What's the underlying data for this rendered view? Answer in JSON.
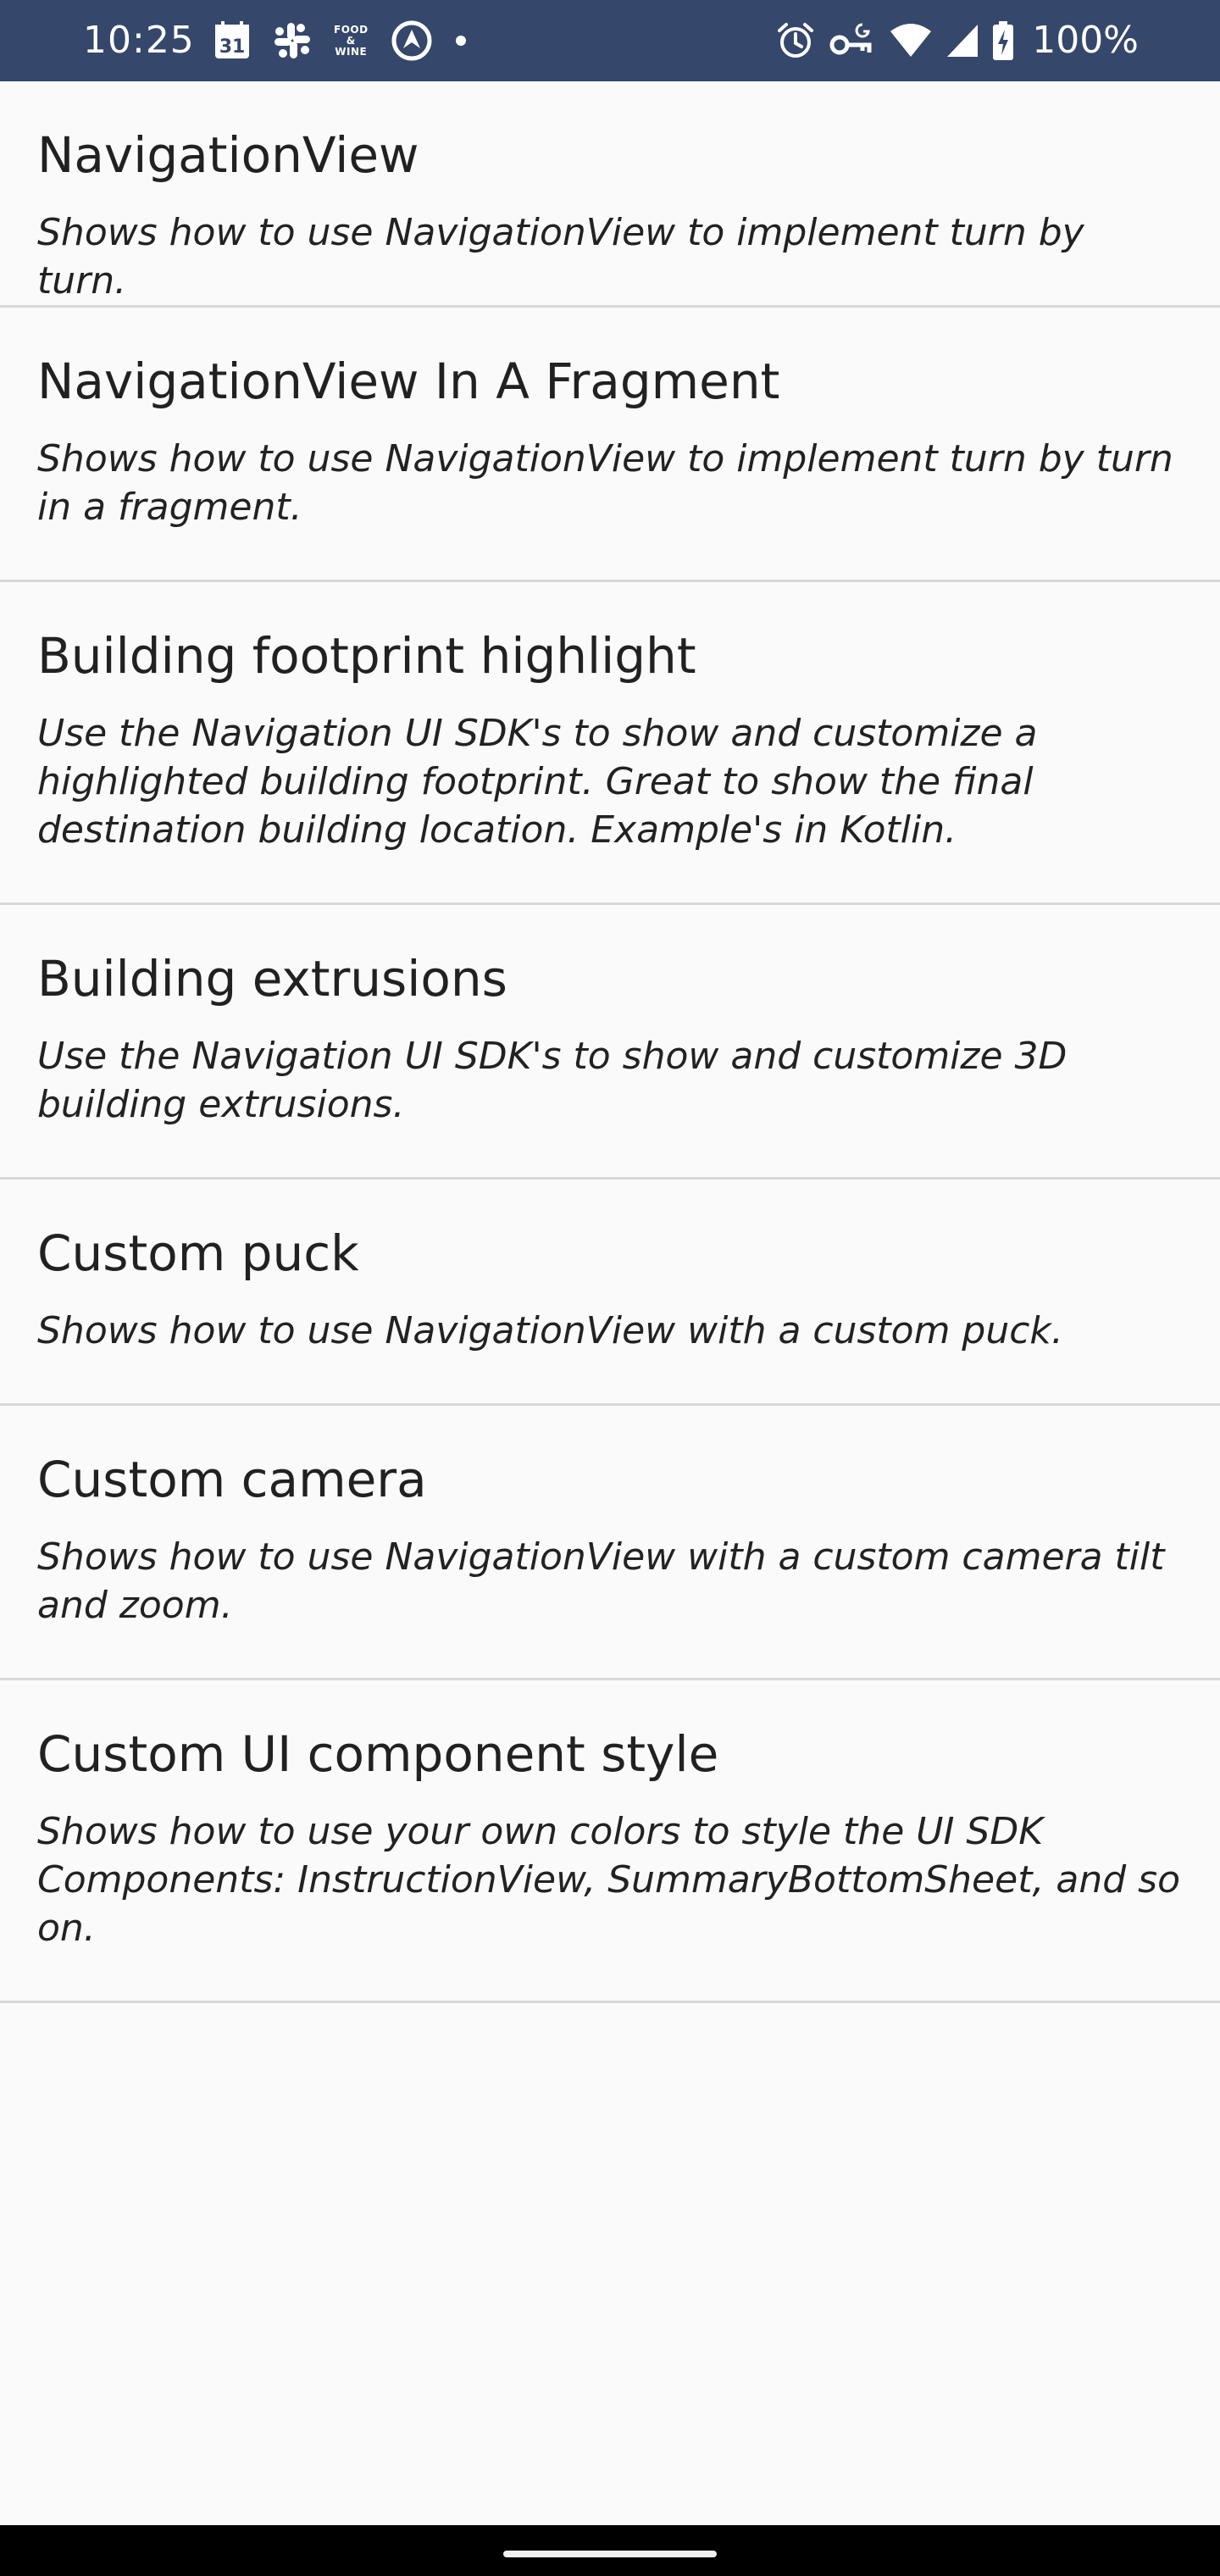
{
  "status_bar": {
    "time": "10:25",
    "calendar_day": "31",
    "food_wine_top": "FOOD",
    "food_wine_mid": "&",
    "food_wine_bottom": "WINE",
    "battery_text": "100%",
    "left_icons": [
      "calendar-icon",
      "slack-icon",
      "food-wine-icon",
      "navigation-app-icon",
      "notification-dot-icon"
    ],
    "right_icons": [
      "alarm-icon",
      "vpn-key-icon",
      "wifi-icon",
      "signal-icon",
      "battery-charging-icon"
    ]
  },
  "examples": [
    {
      "title": "NavigationView",
      "description": "Shows how to use NavigationView to implement turn by turn."
    },
    {
      "title": "NavigationView In A Fragment",
      "description": "Shows how to use NavigationView to implement turn by turn in a fragment."
    },
    {
      "title": "Building footprint highlight",
      "description": "Use the Navigation UI SDK's to show and customize a highlighted building footprint. Great to show the final destination building location. Example's in Kotlin."
    },
    {
      "title": "Building extrusions",
      "description": "Use the Navigation UI SDK's to show and customize 3D building extrusions."
    },
    {
      "title": "Custom puck",
      "description": "Shows how to use NavigationView with a custom puck."
    },
    {
      "title": "Custom camera",
      "description": "Shows how to use NavigationView with a custom camera tilt and zoom."
    },
    {
      "title": "Custom UI component style",
      "description": "Shows how to use your own colors to style the UI SDK Components: InstructionView, SummaryBottomSheet, and so on."
    }
  ],
  "colors": {
    "status_bar": "#35476b",
    "background": "#fafafa",
    "divider": "#d8d8d8",
    "nav_bar": "#000000"
  }
}
